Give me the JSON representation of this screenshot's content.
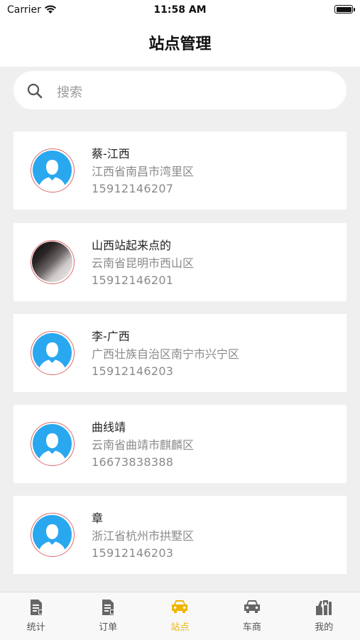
{
  "status_bar": {
    "carrier": "Carrier",
    "time": "11:58 AM"
  },
  "nav": {
    "title": "站点管理"
  },
  "search": {
    "placeholder": "搜索"
  },
  "stations": [
    {
      "name": "蔡-江西",
      "address": "江西省南昌市湾里区",
      "phone": "15912146207",
      "avatar": "default"
    },
    {
      "name": "山西站起来点的",
      "address": "云南省昆明市西山区",
      "phone": "15912146201",
      "avatar": "photo"
    },
    {
      "name": "李-广西",
      "address": "广西壮族自治区南宁市兴宁区",
      "phone": "15912146203",
      "avatar": "default"
    },
    {
      "name": "曲线靖",
      "address": "云南省曲靖市麒麟区",
      "phone": "16673838388",
      "avatar": "default"
    },
    {
      "name": "章",
      "address": "浙江省杭州市拱墅区",
      "phone": "15912146203",
      "avatar": "default"
    }
  ],
  "tabs": [
    {
      "label": "统计",
      "icon": "document-icon",
      "active": false
    },
    {
      "label": "订单",
      "icon": "document-icon",
      "active": false
    },
    {
      "label": "站点",
      "icon": "car-icon",
      "active": true
    },
    {
      "label": "车商",
      "icon": "car-icon",
      "active": false
    },
    {
      "label": "我的",
      "icon": "tools-icon",
      "active": false
    }
  ],
  "colors": {
    "accent": "#f0b400",
    "avatar_blue": "#29a8f0",
    "avatar_border": "#e06a6a",
    "background": "#efefef"
  }
}
